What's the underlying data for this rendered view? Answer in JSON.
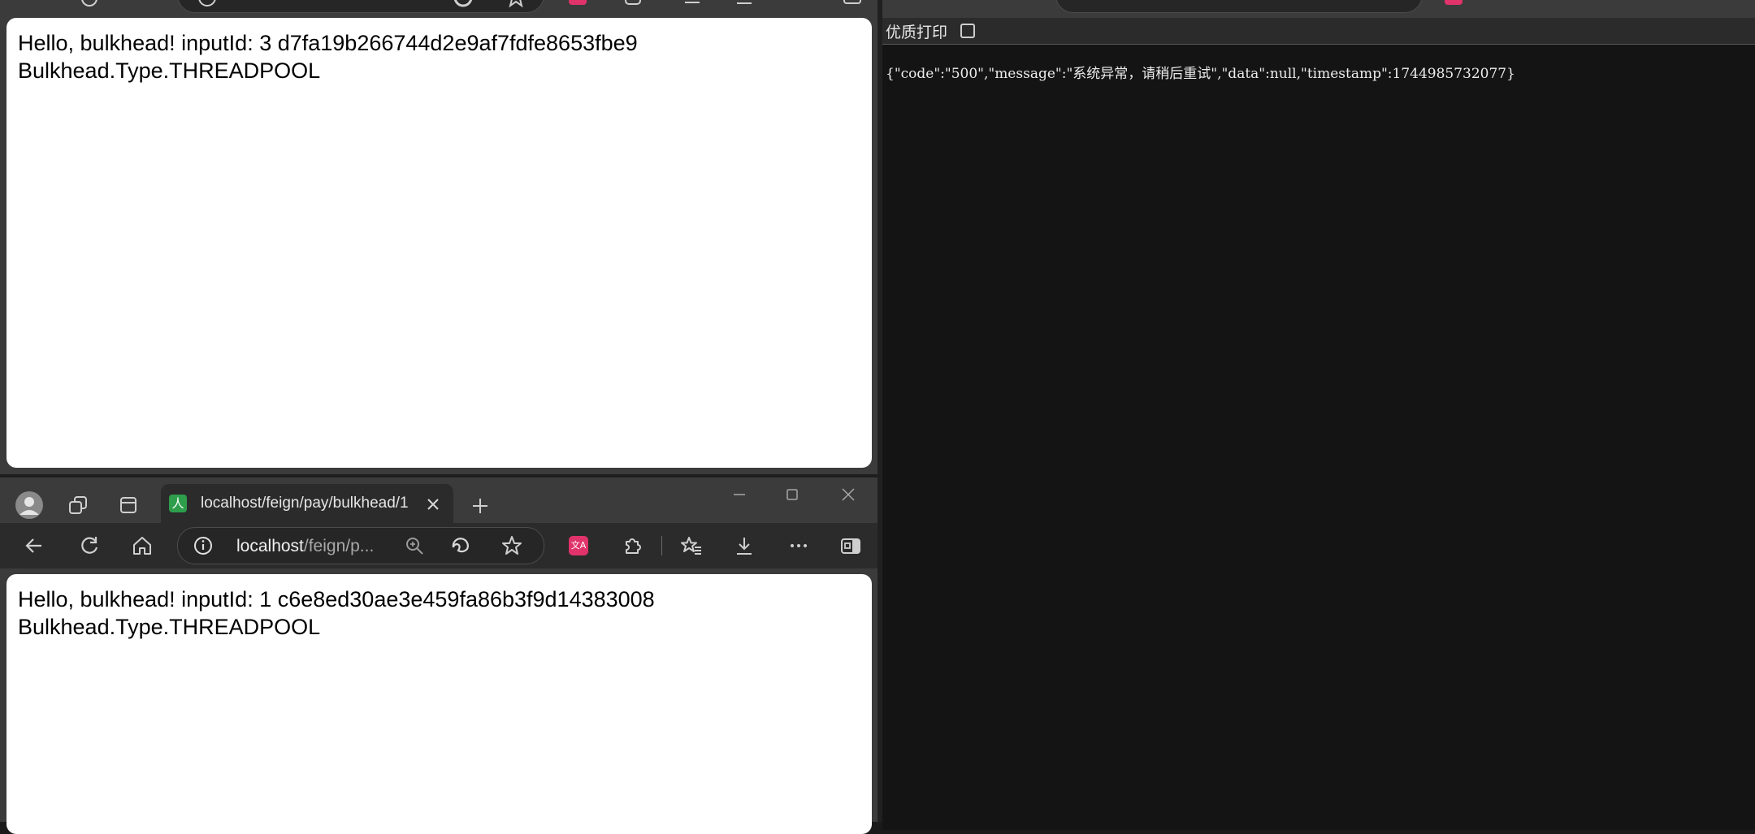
{
  "top_left_window": {
    "page": {
      "line1": "Hello, bulkhead! inputId: 3 d7fa19b266744d2e9af7fdfe8653fbe9",
      "line2": "Bulkhead.Type.THREADPOOL"
    }
  },
  "bottom_left_window": {
    "tab": {
      "title": "localhost/feign/pay/bulkhead/1",
      "favicon_glyph": "人",
      "favicon_color": "#2e9e4c"
    },
    "address": {
      "host": "localhost",
      "path": "/feign/p..."
    },
    "translate_icon_glyph": "文A",
    "translate_icon_color": "#e0336b",
    "page": {
      "line1": "Hello, bulkhead! inputId: 1 c6e8ed30ae3e459fa86b3f9d14383008",
      "line2": "Bulkhead.Type.THREADPOOL"
    }
  },
  "right_window": {
    "pretty_print": {
      "label": "优质打印",
      "checked": false
    },
    "response_text": "{\"code\":\"500\",\"message\":\"系统异常，请稍后重试\",\"data\":null,\"timestamp\":1744985732077}"
  },
  "colors": {
    "chrome_bg": "#3b3b3b",
    "content_bg": "#ffffff",
    "dark_content_bg": "#141414",
    "accent_pink": "#e0336b"
  }
}
